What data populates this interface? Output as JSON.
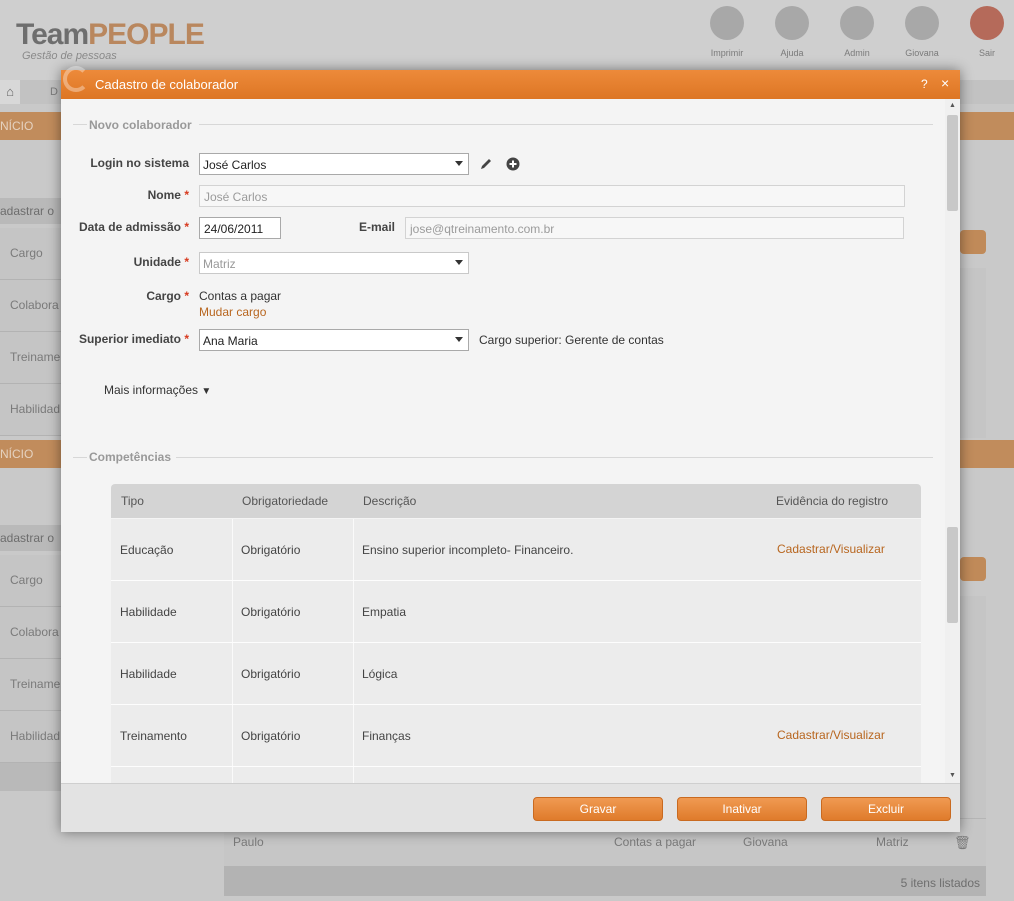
{
  "app": {
    "logo_team": "Team",
    "logo_people": "PEOPLE",
    "logo_subtitle": "Gestão de pessoas",
    "toolbar": [
      "Imprimir",
      "Ajuda",
      "Admin",
      "Giovana",
      "Sair"
    ],
    "nav_text": "D",
    "band_label": "NÍCIO",
    "side_head": "adastrar o",
    "side_items": [
      "Cargo",
      "Colabora",
      "Treiname",
      "Habilidad"
    ],
    "bg_row": {
      "name": "Paulo",
      "cargo": "Contas a pagar",
      "superior": "Giovana",
      "unidade": "Matriz"
    },
    "bg_footer": "5 itens listados"
  },
  "modal": {
    "title": "Cadastro de colaborador",
    "help": "?",
    "close": "×",
    "section_new": "Novo colaborador",
    "login_label": "Login no sistema",
    "login_value": "José Carlos",
    "nome_label": "Nome",
    "nome_value": "José Carlos",
    "admissao_label": "Data de admissão",
    "admissao_value": "24/06/2011",
    "email_label": "E-mail",
    "email_value": "jose@qtreinamento.com.br",
    "unidade_label": "Unidade",
    "unidade_value": "Matriz",
    "cargo_label": "Cargo",
    "cargo_value": "Contas a pagar",
    "mudar_cargo": "Mudar cargo",
    "superior_label": "Superior imediato",
    "superior_value": "Ana Maria",
    "cargo_superior": "Cargo superior: Gerente de contas",
    "mais_info": "Mais informações",
    "required_mark": "*",
    "section_comp": "Competências",
    "table": {
      "headers": [
        "Tipo",
        "Obrigatoriedade",
        "Descrição",
        "Evidência do registro"
      ],
      "rows": [
        {
          "tipo": "Educação",
          "obrig": "Obrigatório",
          "desc": "Ensino superior incompleto- Financeiro.",
          "evid": "Cadastrar/Visualizar"
        },
        {
          "tipo": "Habilidade",
          "obrig": "Obrigatório",
          "desc": "Empatia",
          "evid": ""
        },
        {
          "tipo": "Habilidade",
          "obrig": "Obrigatório",
          "desc": "Lógica",
          "evid": ""
        },
        {
          "tipo": "Treinamento",
          "obrig": "Obrigatório",
          "desc": "Finanças",
          "evid": "Cadastrar/Visualizar"
        }
      ]
    },
    "buttons": {
      "gravar": "Gravar",
      "inativar": "Inativar",
      "excluir": "Excluir"
    }
  },
  "colors": {
    "accent": "#e07a28",
    "link": "#b8661f",
    "required": "#d73a1f"
  }
}
